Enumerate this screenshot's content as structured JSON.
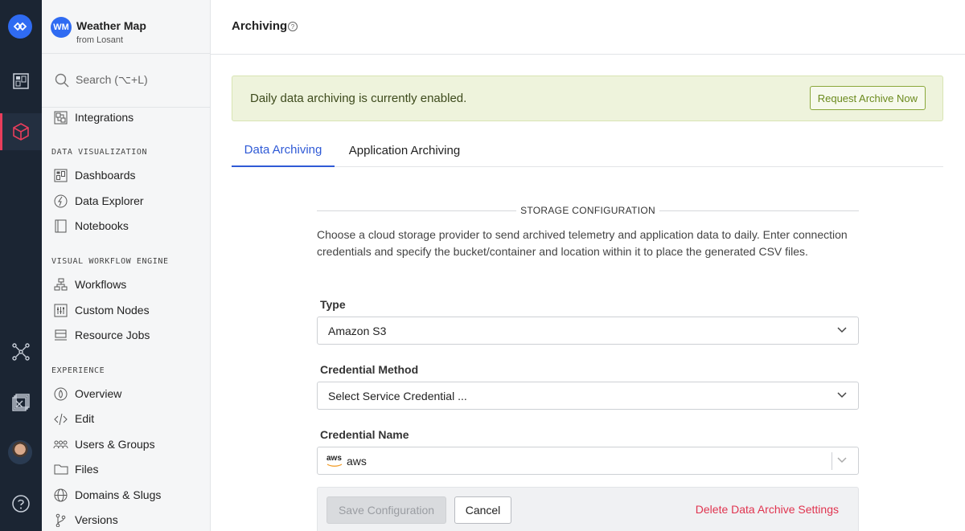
{
  "app": {
    "badge": "WM",
    "name": "Weather Map",
    "subtitle": "from Losant"
  },
  "search": {
    "placeholder": "Search (⌥+L)"
  },
  "sidebar": {
    "top_items": [
      {
        "label": "Integrations",
        "icon": "integrations-icon"
      }
    ],
    "sections": [
      {
        "title": "DATA VISUALIZATION",
        "items": [
          {
            "label": "Dashboards",
            "icon": "dashboard-icon"
          },
          {
            "label": "Data Explorer",
            "icon": "data-explorer-icon"
          },
          {
            "label": "Notebooks",
            "icon": "notebook-icon"
          }
        ]
      },
      {
        "title": "VISUAL WORKFLOW ENGINE",
        "items": [
          {
            "label": "Workflows",
            "icon": "workflow-icon"
          },
          {
            "label": "Custom Nodes",
            "icon": "custom-nodes-icon"
          },
          {
            "label": "Resource Jobs",
            "icon": "resource-jobs-icon"
          }
        ]
      },
      {
        "title": "EXPERIENCE",
        "items": [
          {
            "label": "Overview",
            "icon": "overview-icon"
          },
          {
            "label": "Edit",
            "icon": "code-edit-icon"
          },
          {
            "label": "Users & Groups",
            "icon": "users-groups-icon"
          },
          {
            "label": "Files",
            "icon": "folder-icon"
          },
          {
            "label": "Domains & Slugs",
            "icon": "globe-icon"
          },
          {
            "label": "Versions",
            "icon": "branch-icon"
          }
        ]
      }
    ]
  },
  "page": {
    "title": "Archiving"
  },
  "banner": {
    "text": "Daily data archiving is currently enabled.",
    "button": "Request Archive Now"
  },
  "tabs": [
    {
      "label": "Data Archiving",
      "active": true
    },
    {
      "label": "Application Archiving",
      "active": false
    }
  ],
  "storage": {
    "heading": "STORAGE CONFIGURATION",
    "description": "Choose a cloud storage provider to send archived telemetry and application data to daily. Enter connection credentials and specify the bucket/container and location within it to place the generated CSV files.",
    "type_label": "Type",
    "type_value": "Amazon S3",
    "credential_method_label": "Credential Method",
    "credential_method_value": "Select Service Credential ...",
    "credential_name_label": "Credential Name",
    "credential_name_logo": "aws",
    "credential_name_value": "aws"
  },
  "actions": {
    "save": "Save Configuration",
    "cancel": "Cancel",
    "delete": "Delete Data Archive Settings"
  },
  "colors": {
    "rail_bg": "#1b2533",
    "brand": "#2f6bf2",
    "active_marker": "#e83d5b",
    "tab_active": "#2f5ad6",
    "banner_bg": "#eef3dc",
    "delete": "#e0344f"
  }
}
